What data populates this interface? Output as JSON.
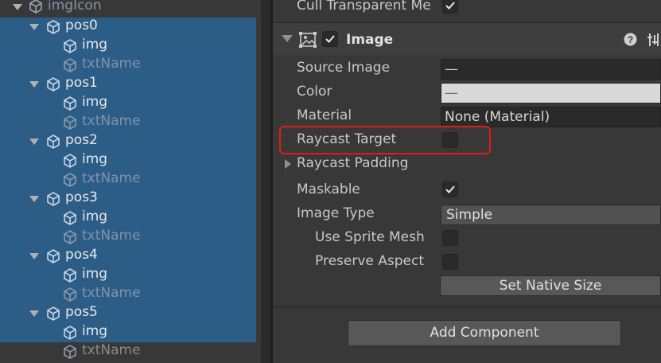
{
  "hierarchy": {
    "root": "imgIcon",
    "groups": [
      {
        "name": "pos0",
        "children": [
          "img",
          "txtName"
        ]
      },
      {
        "name": "pos1",
        "children": [
          "img",
          "txtName"
        ]
      },
      {
        "name": "pos2",
        "children": [
          "img",
          "txtName"
        ]
      },
      {
        "name": "pos3",
        "children": [
          "img",
          "txtName"
        ]
      },
      {
        "name": "pos4",
        "children": [
          "img",
          "txtName"
        ]
      },
      {
        "name": "pos5",
        "children": [
          "img",
          "txtName"
        ]
      }
    ]
  },
  "inspector": {
    "top_row_label": "Cull Transparent Me",
    "component_title": "Image",
    "source_image_label": "Source Image",
    "source_image_value": "—",
    "color_label": "Color",
    "color_value": "—",
    "material_label": "Material",
    "material_value": "None (Material)",
    "raycast_target_label": "Raycast Target",
    "raycast_padding_label": "Raycast Padding",
    "maskable_label": "Maskable",
    "image_type_label": "Image Type",
    "image_type_value": "Simple",
    "use_sprite_mesh_label": "Use Sprite Mesh",
    "preserve_aspect_label": "Preserve Aspect",
    "set_native_size_label": "Set Native Size",
    "add_component_label": "Add Component",
    "checked": {
      "cull_transparent": true,
      "image_enabled": true,
      "raycast_target": false,
      "maskable": true,
      "use_sprite_mesh": false,
      "preserve_aspect": false
    },
    "colors": {
      "highlight": "#e21a1a",
      "selection": "#2c5d87",
      "color_swatch": "#d9d9d9"
    }
  }
}
